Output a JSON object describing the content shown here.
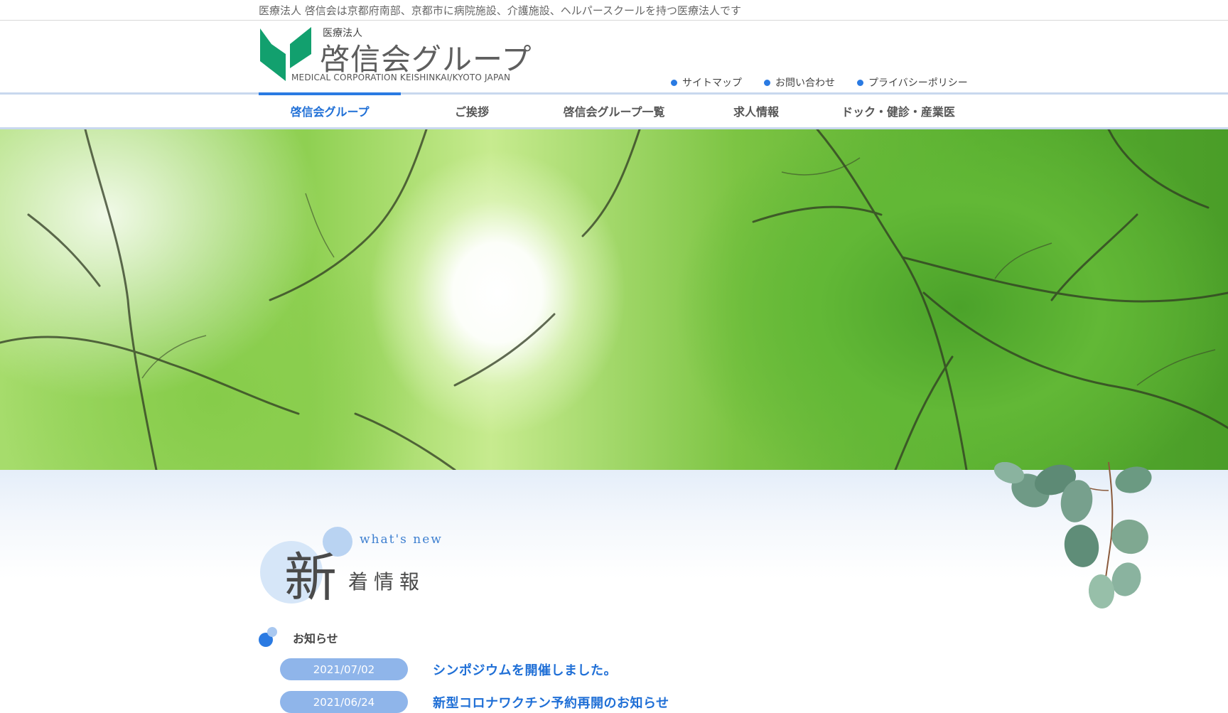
{
  "tagline": "医療法人 啓信会は京都府南部、京都市に病院施設、介護施設、ヘルパースクールを持つ医療法人です",
  "logo": {
    "small": "医療法人",
    "main": "啓信会グループ",
    "english": "MEDICAL CORPORATION KEISHINKAI/KYOTO JAPAN",
    "mark_color": "#12a06e"
  },
  "util_links": [
    {
      "label": "サイトマップ"
    },
    {
      "label": "お問い合わせ"
    },
    {
      "label": "プライバシーポリシー"
    }
  ],
  "nav": [
    {
      "label": "啓信会グループ",
      "active": true
    },
    {
      "label": "ご挨拶"
    },
    {
      "label": "啓信会グループ一覧"
    },
    {
      "label": "求人情報"
    },
    {
      "label": "ドック・健診・産業医"
    }
  ],
  "section": {
    "kanji_big": "新",
    "kanji_rest": "着情報",
    "subtitle": "what's new"
  },
  "news": {
    "category": "お知らせ",
    "items": [
      {
        "date": "2021/07/02",
        "title": "シンポジウムを開催しました。"
      },
      {
        "date": "2021/06/24",
        "title": "新型コロナワクチン予約再開のお知らせ"
      }
    ]
  },
  "colors": {
    "accent": "#2a7ae2",
    "date_pill": "#8fb5ea",
    "nav_line": "#c8d8ee"
  }
}
